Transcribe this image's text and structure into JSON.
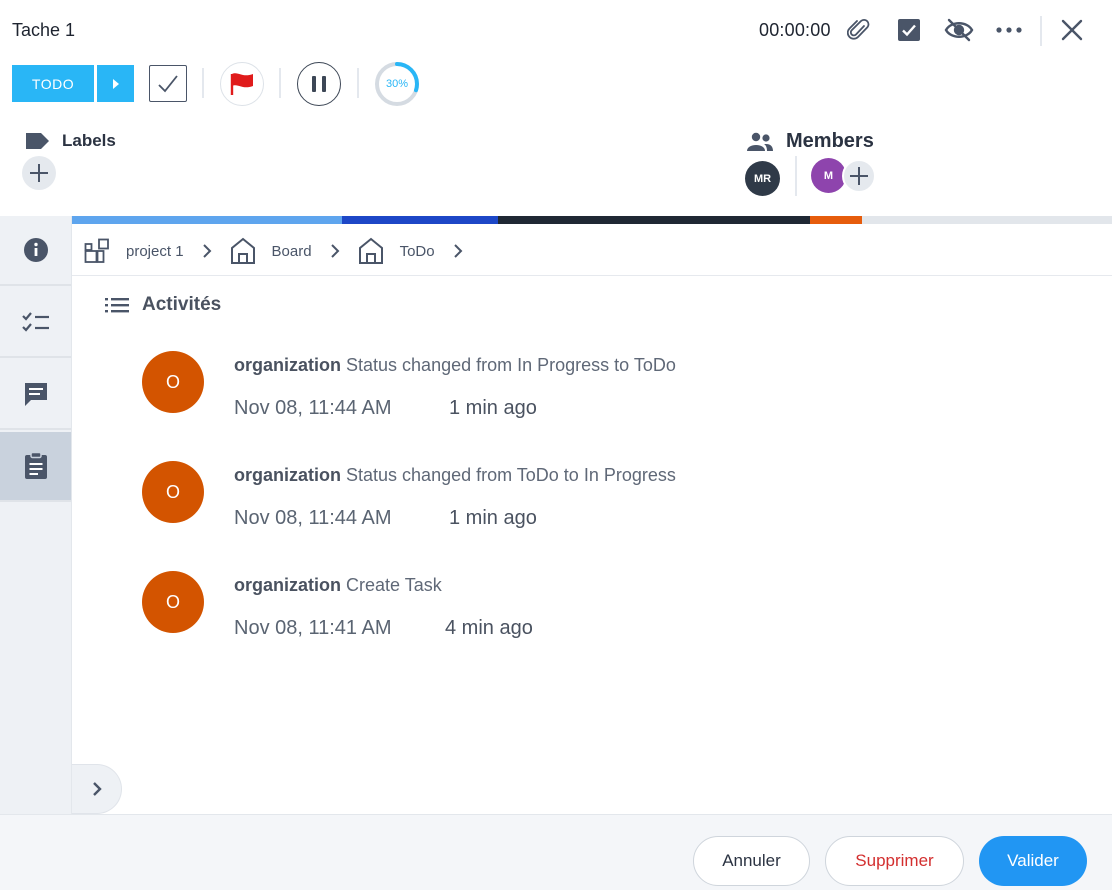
{
  "header": {
    "title": "Tache 1",
    "timer": "00:00:00"
  },
  "toolbar": {
    "status_label": "TODO",
    "progress_label": "30%",
    "progress_value": 0.3
  },
  "labels": {
    "title": "Labels"
  },
  "members": {
    "title": "Members",
    "avatars": [
      {
        "initials": "MR",
        "color": "#2f3a48"
      },
      {
        "initials": "M",
        "color": "#8e44ad"
      }
    ]
  },
  "status_stripe": [
    {
      "color": "#5ea5ee",
      "weight": 26
    },
    {
      "color": "#1d47c7",
      "weight": 15
    },
    {
      "color": "#1f2834",
      "weight": 30
    },
    {
      "color": "#e65c0c",
      "weight": 5
    },
    {
      "color": "#e2e6eb",
      "weight": 24
    }
  ],
  "breadcrumb": {
    "items": [
      "project 1",
      "Board",
      "ToDo"
    ]
  },
  "activities": {
    "title": "Activités",
    "items": [
      {
        "avatar": "O",
        "actor": "organization",
        "text": "Status changed from In Progress to ToDo",
        "date": "Nov 08, 11:44 AM",
        "ago": "1 min ago"
      },
      {
        "avatar": "O",
        "actor": "organization",
        "text": "Status changed from ToDo to In Progress",
        "date": "Nov 08, 11:44 AM",
        "ago": "1 min ago"
      },
      {
        "avatar": "O",
        "actor": "organization",
        "text": "Create Task",
        "date": "Nov 08, 11:41 AM",
        "ago": "4 min ago"
      }
    ]
  },
  "footer": {
    "cancel_label": "Annuler",
    "delete_label": "Supprimer",
    "ok_label": "Valider"
  },
  "colors": {
    "accent": "#29b6f6",
    "primary": "#2196f3",
    "danger": "#d32f2f",
    "activity_avatar": "#d35400",
    "flag": "#e01b1b"
  }
}
